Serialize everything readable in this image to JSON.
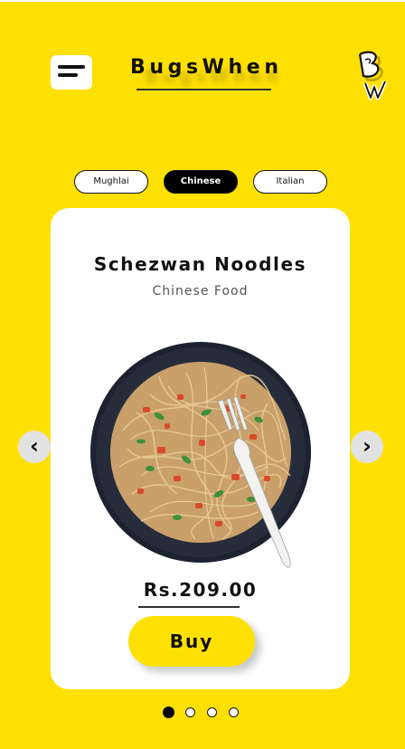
{
  "header": {
    "brand": "BugsWhen",
    "menu_icon": "hamburger-menu-icon",
    "logo_icon": "bw-logo-icon"
  },
  "tabs": [
    {
      "label": "Mughlai",
      "active": false
    },
    {
      "label": "Chinese",
      "active": true
    },
    {
      "label": "Italian",
      "active": false
    }
  ],
  "card": {
    "title": "Schezwan Noodles",
    "subtitle": "Chinese Food",
    "image": "noodles-plate-image",
    "price": "Rs.209.00",
    "buy_label": "Buy"
  },
  "carousel": {
    "prev_icon": "chevron-left-icon",
    "next_icon": "chevron-right-icon",
    "prev_glyph": "‹",
    "next_glyph": "›",
    "page_count": 4,
    "active_index": 0
  },
  "colors": {
    "background": "#ffe003",
    "card": "#ffffff",
    "accent_dark": "#000000"
  }
}
